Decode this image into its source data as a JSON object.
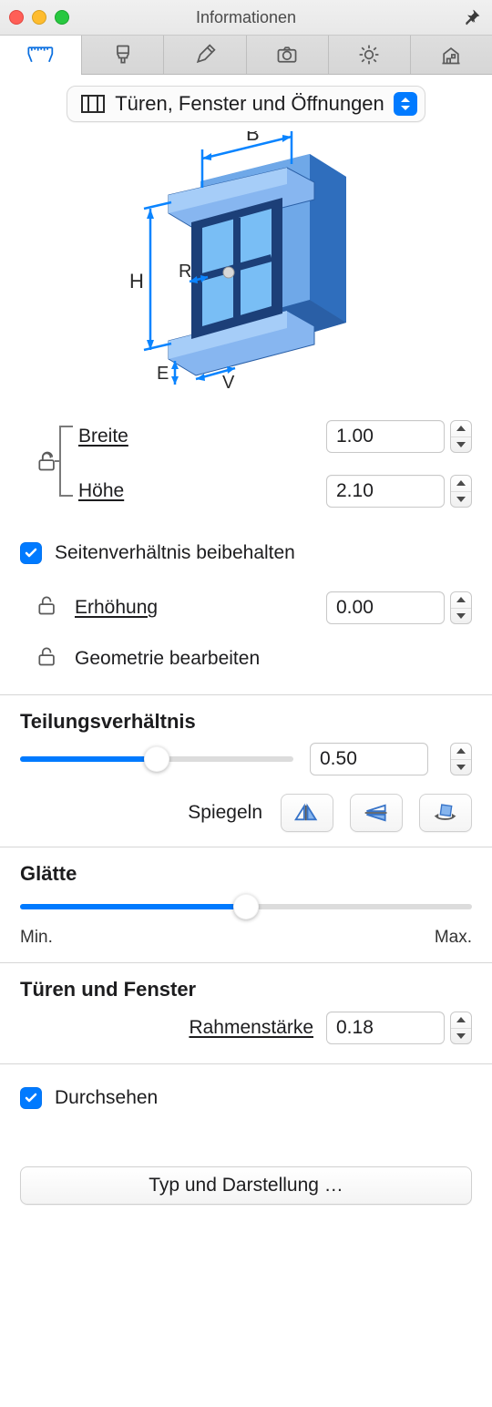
{
  "titlebar": {
    "title": "Informationen"
  },
  "dropdown": {
    "label": "Türen, Fenster und Öffnungen"
  },
  "dims": {
    "breite_label": "Breite",
    "breite_value": "1.00",
    "hoehe_label": "Höhe",
    "hoehe_value": "2.10"
  },
  "aspect": {
    "label": "Seitenverhältnis beibehalten"
  },
  "erhoehung": {
    "label": "Erhöhung",
    "value": "0.00"
  },
  "geom": {
    "label": "Geometrie bearbeiten"
  },
  "teilung": {
    "heading": "Teilungsverhältnis",
    "value": "0.50",
    "mirror_label": "Spiegeln"
  },
  "glaette": {
    "heading": "Glätte",
    "min": "Min.",
    "max": "Max."
  },
  "rahmen": {
    "heading": "Türen und Fenster",
    "label": "Rahmenstärke",
    "value": "0.18"
  },
  "durchsehen": {
    "label": "Durchsehen"
  },
  "type_btn": {
    "label": "Typ und Darstellung …"
  },
  "diagram_labels": {
    "b": "B",
    "h": "H",
    "r": "R",
    "e": "E",
    "v": "V"
  }
}
